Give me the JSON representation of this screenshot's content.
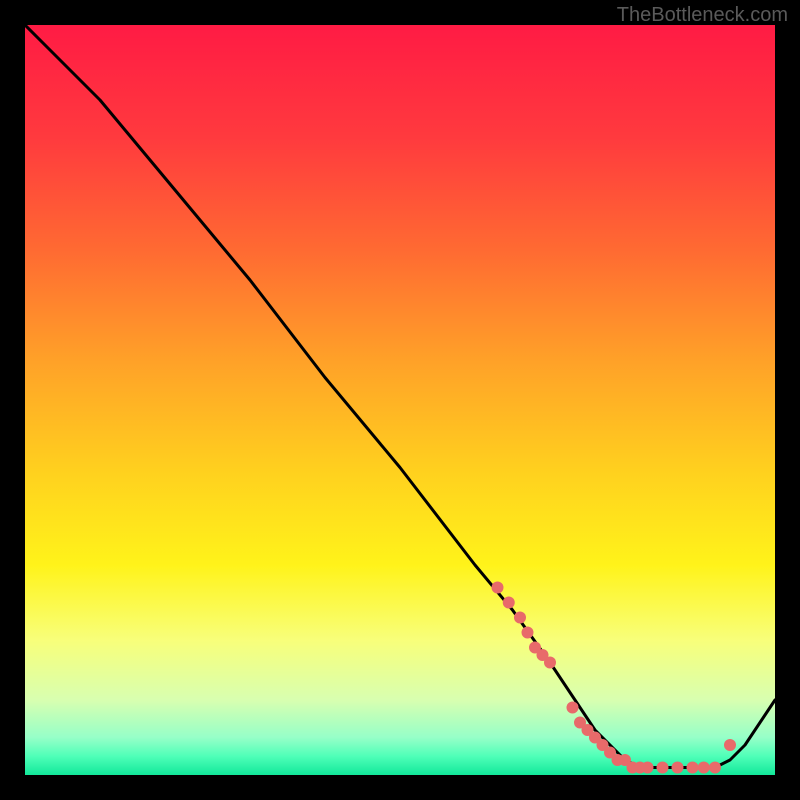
{
  "watermark": "TheBottleneck.com",
  "chart_data": {
    "type": "line",
    "title": "",
    "xlabel": "",
    "ylabel": "",
    "xlim": [
      0,
      100
    ],
    "ylim": [
      0,
      100
    ],
    "grid": false,
    "legend": false,
    "background_gradient": {
      "stops": [
        {
          "offset": 0.0,
          "color": "#ff1b44"
        },
        {
          "offset": 0.15,
          "color": "#ff3a3e"
        },
        {
          "offset": 0.3,
          "color": "#ff6a32"
        },
        {
          "offset": 0.45,
          "color": "#ffa228"
        },
        {
          "offset": 0.6,
          "color": "#ffd21e"
        },
        {
          "offset": 0.72,
          "color": "#fff31a"
        },
        {
          "offset": 0.82,
          "color": "#f8ff7a"
        },
        {
          "offset": 0.9,
          "color": "#d8ffb0"
        },
        {
          "offset": 0.95,
          "color": "#96ffc8"
        },
        {
          "offset": 0.975,
          "color": "#4fffb8"
        },
        {
          "offset": 1.0,
          "color": "#12e89a"
        }
      ]
    },
    "series": [
      {
        "name": "bottleneck-curve",
        "type": "line",
        "color": "#000000",
        "x": [
          0,
          3,
          6,
          10,
          15,
          20,
          30,
          40,
          50,
          60,
          65,
          70,
          72,
          74,
          76,
          78,
          80,
          82,
          84,
          86,
          88,
          90,
          92,
          94,
          96,
          98,
          100
        ],
        "y": [
          100,
          97,
          94,
          90,
          84,
          78,
          66,
          53,
          41,
          28,
          22,
          15,
          12,
          9,
          6,
          4,
          2,
          1,
          1,
          1,
          1,
          1,
          1,
          2,
          4,
          7,
          10
        ]
      },
      {
        "name": "highlight-points",
        "type": "scatter",
        "color": "#e86a6a",
        "x": [
          63,
          64.5,
          66,
          67,
          68,
          69,
          70,
          73,
          74,
          75,
          76,
          77,
          78,
          79,
          80,
          81,
          82,
          83,
          85,
          87,
          89,
          90.5,
          92,
          94
        ],
        "y": [
          25,
          23,
          21,
          19,
          17,
          16,
          15,
          9,
          7,
          6,
          5,
          4,
          3,
          2,
          2,
          1,
          1,
          1,
          1,
          1,
          1,
          1,
          1,
          4
        ]
      }
    ]
  }
}
